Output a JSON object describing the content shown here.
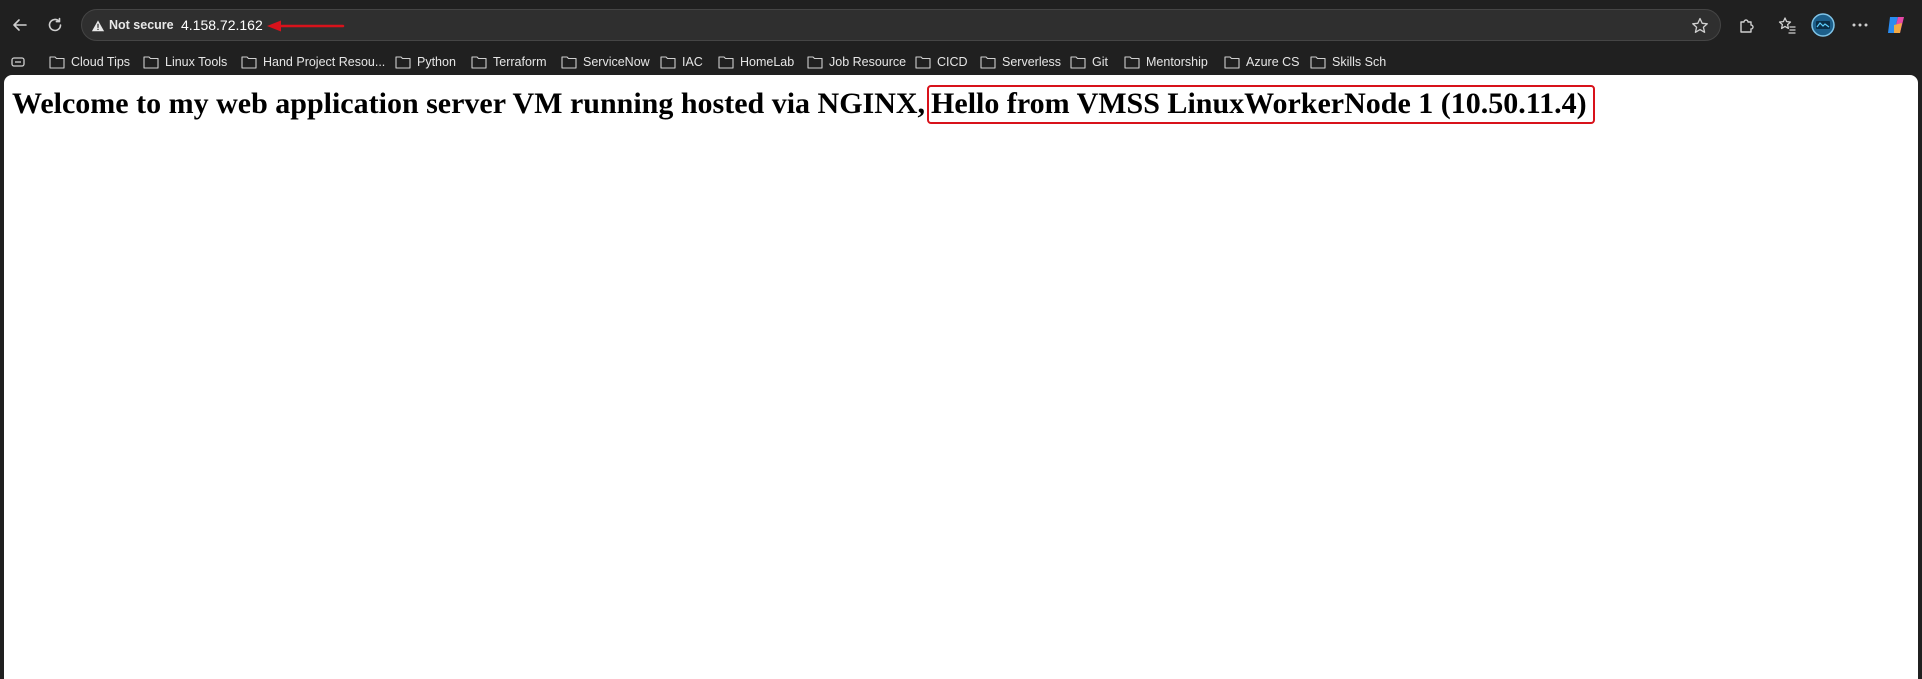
{
  "browser": {
    "address_bar": {
      "security_label": "Not secure",
      "url": "4.158.72.162"
    },
    "bookmarks": [
      {
        "label": "Cloud Tips"
      },
      {
        "label": "Linux Tools"
      },
      {
        "label": "Hand Project Resou..."
      },
      {
        "label": "Python"
      },
      {
        "label": "Terraform"
      },
      {
        "label": "ServiceNow"
      },
      {
        "label": "IAC"
      },
      {
        "label": "HomeLab"
      },
      {
        "label": "Job Resource"
      },
      {
        "label": "CICD"
      },
      {
        "label": "Serverless"
      },
      {
        "label": "Git"
      },
      {
        "label": "Mentorship"
      },
      {
        "label": "Azure CS"
      },
      {
        "label": "Skills Sch"
      }
    ],
    "icons": {
      "back": "back-arrow-icon",
      "refresh": "refresh-icon",
      "warning": "warning-triangle-icon",
      "favorite": "star-icon",
      "extensions": "puzzle-icon",
      "favorites": "favorites-list-icon",
      "profile": "avatar",
      "more": "more-icon",
      "copilot": "copilot-icon"
    },
    "annotation_color": "#d8121b"
  },
  "page": {
    "headline_prefix": "Welcome to my web application server VM running hosted via NGINX,",
    "headline_highlight": "Hello from VMSS LinuxWorkerNode 1 (10.50.11.4)"
  }
}
